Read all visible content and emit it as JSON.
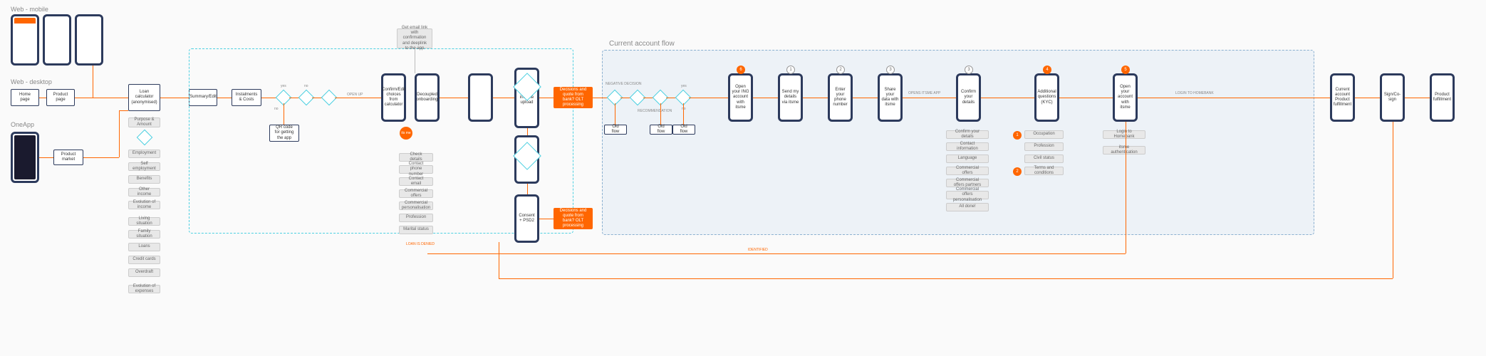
{
  "sections": {
    "web_mobile": "Web - mobile",
    "web_desktop": "Web - desktop",
    "oneapp": "OneApp",
    "current_account": "Current account flow"
  },
  "entry": {
    "home_page": "Home page",
    "product_page": "Product page",
    "product_market": "Product market"
  },
  "screens": {
    "loan_calc": "Loan calculator (anonymised)",
    "summary_edit": "Summary/Edit",
    "instalments": "Instalments & Costs",
    "confirm_edit": "Confirm/Edit choices from calculator",
    "decoupled": "Decoupled onboarding",
    "proof_income": "Proof of income upload",
    "consent_psd2": "Consent + PSD2",
    "open_ing": "Open your ING account with itsme",
    "send_details": "Send my details via itsme",
    "enter_phone": "Enter your phone number",
    "share_data": "Share your data with itsme",
    "confirm_details": "Confirm your details",
    "additional_kyc": "Additional questions (KYC)",
    "open_account": "Open your account with itsme",
    "current_fulfil": "Current account Product fulfillment",
    "sign_co": "Sign/Co-sign",
    "product_fulfil": "Product fulfillment"
  },
  "notes": {
    "email_link": "Get email link with confirmation and deeplink to the app",
    "qr_code": "QR code for getting the app",
    "decisions1": "Decisions and quote from bank? OLT processing",
    "decisions2": "Decisions and quote from bank? OLT processing",
    "purpose_amount": "Purpose & Amount",
    "check_details": "Check details",
    "contact_phone": "Contact phone number",
    "contact_email": "Contact email",
    "commercial_offers": "Commercial offers",
    "commercial_pers": "Commercial personalisation",
    "profession": "Profession",
    "marital": "Marital status",
    "qna": {
      "employment": "Employment",
      "self_emp": "Self employment",
      "benefits": "Benefits",
      "other_income": "Other income",
      "evolution_income": "Evolution of income",
      "living": "Living situation",
      "family": "Family situation",
      "loans": "Loans",
      "credit": "Credit cards",
      "overdraft": "Overdraft",
      "evolution_exp": "Evolution of expenses"
    },
    "confirm_col": {
      "confirm": "Confirm your details",
      "contact_info": "Contact information",
      "language": "Language",
      "comm_offers": "Commercial offers",
      "comm_offers_p": "Commercial offers partners",
      "comm_offers_s": "Commercial offers personalisation",
      "all_done": "All done!"
    },
    "kyc_col": {
      "occupation": "Occupation",
      "profession": "Profession",
      "civil": "Civil status",
      "terms": "Terms and conditions"
    },
    "open_col": {
      "login_hb": "Login to Homebank",
      "itsme_auth": "itsme authentication"
    },
    "old_flow": "Old flow"
  },
  "edges": {
    "no": "no",
    "yes": "yes",
    "neg_decision": "NEGATIVE DECISION",
    "recommendation": "RECOMMENDATION",
    "loan_deny": "LOAN IS DENIED",
    "open_itsme": "OPENS ITSME APP",
    "login_hb": "LOGIN TO HOMEBANK",
    "open_up": "OPEN UP",
    "identified": "IDENTIFIED"
  },
  "badges": {
    "b1": "1",
    "b2": "2",
    "b3": "3",
    "b4": "4",
    "b5": "5",
    "b6": "6"
  },
  "itsme": "its me"
}
